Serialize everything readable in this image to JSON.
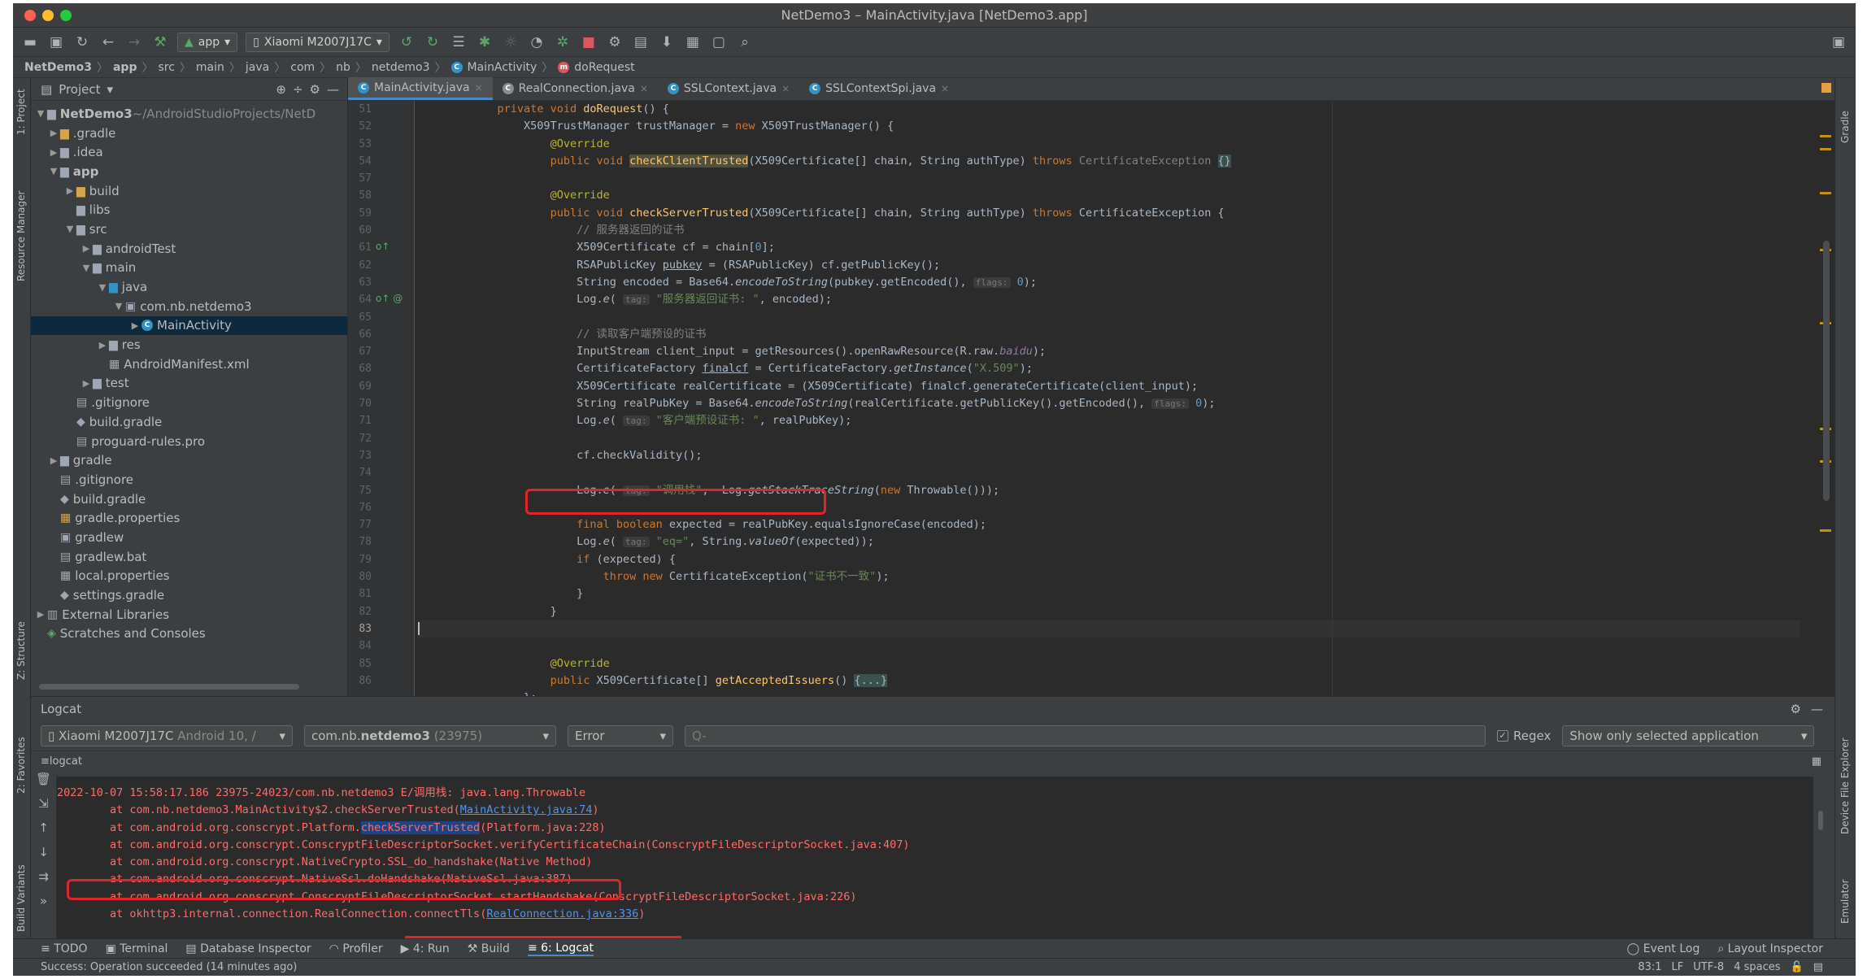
{
  "window": {
    "title": "NetDemo3 – MainActivity.java [NetDemo3.app]"
  },
  "toolbar": {
    "config": "app",
    "device": "Xiaomi M2007J17C"
  },
  "breadcrumb": [
    "NetDemo3",
    "app",
    "src",
    "main",
    "java",
    "com",
    "nb",
    "netdemo3",
    "MainActivity",
    "doRequest"
  ],
  "project": {
    "title": "Project",
    "root_name": "NetDemo3",
    "root_path": "~/AndroidStudioProjects/NetD",
    "items": [
      ".gradle",
      ".idea",
      "app",
      "build",
      "libs",
      "src",
      "androidTest",
      "main",
      "java",
      "com.nb.netdemo3",
      "MainActivity",
      "res",
      "AndroidManifest.xml",
      "test",
      ".gitignore",
      "build.gradle",
      "proguard-rules.pro",
      "gradle",
      ".gitignore",
      "build.gradle",
      "gradle.properties",
      "gradlew",
      "gradlew.bat",
      "local.properties",
      "settings.gradle",
      "External Libraries",
      "Scratches and Consoles"
    ]
  },
  "tabs": [
    "MainActivity.java",
    "RealConnection.java",
    "SSLContext.java",
    "SSLContextSpi.java"
  ],
  "line_numbers": [
    "51",
    "52",
    "53",
    "54",
    "57",
    "58",
    "59",
    "60",
    "61",
    "62",
    "63",
    "64",
    "65",
    "66",
    "67",
    "68",
    "69",
    "70",
    "71",
    "72",
    "73",
    "74",
    "75",
    "76",
    "77",
    "78",
    "79",
    "80",
    "81",
    "82",
    "83",
    "84",
    "85",
    "86"
  ],
  "code": {
    "l51a": "private void ",
    "l51b": "doRequest",
    "l51c": "() {",
    "l52a": "X509TrustManager trustManager = ",
    "l52b": "new ",
    "l52c": "X509TrustManager() {",
    "l53": "@Override",
    "l54a": "public void ",
    "l54b": "checkClientTrusted",
    "l54c": "(X509Certificate[] chain, String authType) ",
    "l54d": "throws ",
    "l54e": "CertificateException ",
    "l54f": "{}",
    "l58": "@Override",
    "l59a": "public void ",
    "l59b": "checkServerTrusted",
    "l59c": "(X509Certificate[] chain, String authType) ",
    "l59d": "throws ",
    "l59e": "CertificateException {",
    "l60": "// 服务器返回的证书",
    "l61a": "X509Certificate cf = chain[",
    "l61b": "0",
    "l61c": "];",
    "l62a": "RSAPublicKey ",
    "l62b": "pubkey",
    "l62c": " = (RSAPublicKey) cf.getPublicKey();",
    "l63a": "String encoded = Base64.",
    "l63b": "encodeToString",
    "l63c": "(pubkey.getEncoded(), ",
    "l63d": "flags:",
    "l63e": " 0",
    "l63f": ");",
    "l64a": "Log.",
    "l64b": "e",
    "l64c": "( ",
    "l64d": "tag:",
    "l64e": " \"服务器返回证书: \"",
    "l64f": ", encoded);",
    "l66": "// 读取客户端预设的证书",
    "l67a": "InputStream client_input = getResources().openRawResource(R.raw.",
    "l67b": "baidu",
    "l67c": ");",
    "l68a": "CertificateFactory ",
    "l68b": "finalcf",
    "l68c": " = CertificateFactory.",
    "l68d": "getInstance",
    "l68e": "(",
    "l68f": "\"X.509\"",
    "l68g": ");",
    "l69": "X509Certificate realCertificate = (X509Certificate) finalcf.generateCertificate(client_input);",
    "l70a": "String realPubKey = Base64.",
    "l70b": "encodeToString",
    "l70c": "(realCertificate.getPublicKey().getEncoded(), ",
    "l70d": "flags:",
    "l70e": " 0",
    "l70f": ");",
    "l71a": "Log.",
    "l71b": "e",
    "l71c": "( ",
    "l71d": "tag:",
    "l71e": " \"客户端预设证书: \"",
    "l71f": ", realPubKey);",
    "l73": "cf.checkValidity();",
    "l75a": "Log.",
    "l75b": "e",
    "l75c": "( ",
    "l75d": "tag:",
    "l75e": " \"调用栈\"",
    "l75f": ",  Log.",
    "l75g": "getStackTraceString",
    "l75h": "(",
    "l75i": "new ",
    "l75j": "Throwable()));",
    "l77a": "final boolean ",
    "l77b": "expected = realPubKey.equalsIgnoreCase(encoded);",
    "l78a": "Log.",
    "l78b": "e",
    "l78c": "( ",
    "l78d": "tag:",
    "l78e": " \"eq=\"",
    "l78f": ", String.",
    "l78g": "valueOf",
    "l78h": "(expected));",
    "l79a": "if ",
    "l79b": "(expected) {",
    "l80a": "throw new ",
    "l80b": "CertificateException(",
    "l80c": "\"证书不一致\"",
    "l80d": ");",
    "l81": "}",
    "l82": "}",
    "l84": "@Override",
    "l85a": "public ",
    "l85b": "X509Certificate[] ",
    "l85c": "getAcceptedIssuers",
    "l85d": "() ",
    "l85e": "{...}",
    "l86": "};"
  },
  "logcat": {
    "title": "Logcat",
    "device": "Xiaomi M2007J17C",
    "device_extra": "Android 10, /",
    "process": "com.nb.",
    "process_bold": "netdemo3",
    "process_pid": "(23975)",
    "level": "Error",
    "search_placeholder": "Q-",
    "regex": "Regex",
    "filter": "Show only selected application",
    "tab": "logcat",
    "lines": [
      {
        "a": "2022-10-07 15:58:17.186 23975-24023/com.nb.netdemo3 E/调用栈: java.lang.Throwable"
      },
      {
        "a": "        at com.nb.netdemo3.MainActivity$2.checkServerTrusted(",
        "b": "MainActivity.java:74",
        "c": ")"
      },
      {
        "a": "        at com.android.org.conscrypt.Platform.",
        "b": "checkServerTrusted",
        "c": "(Platform.java:228)"
      },
      {
        "a": "        at com.android.org.conscrypt.ConscryptFileDescriptorSocket.verifyCertificateChain(ConscryptFileDescriptorSocket.java:407)"
      },
      {
        "a": "        at com.android.org.conscrypt.NativeCrypto.SSL_do_handshake(Native Method)"
      },
      {
        "a": "        at com.android.org.conscrypt.NativeSsl.doHandshake(NativeSsl.java:387)"
      },
      {
        "a": "        at com.android.org.conscrypt.ConscryptFileDescriptorSocket.startHandshake(ConscryptFileDescriptorSocket.java:226)"
      },
      {
        "a": "        at okhttp3.internal.connection.RealConnection.",
        "b": "connectTls",
        "c": "(",
        "d": "RealConnection.java:336",
        "e": ")"
      }
    ]
  },
  "bottom_tabs": [
    "TODO",
    "Terminal",
    "Database Inspector",
    "Profiler",
    "4: Run",
    "Build",
    "6: Logcat"
  ],
  "bottom_right": [
    "Event Log",
    "Layout Inspector"
  ],
  "status": {
    "message": "Success: Operation succeeded (14 minutes ago)",
    "pos": "83:1",
    "lf": "LF",
    "enc": "UTF-8",
    "indent": "4 spaces"
  },
  "side_labels": {
    "project": "1: Project",
    "resource": "Resource Manager",
    "structure": "Z: Structure",
    "favorites": "2: Favorites",
    "variants": "Build Variants",
    "gradle": "Gradle",
    "device_explorer": "Device File Explorer",
    "emulator": "Emulator"
  }
}
